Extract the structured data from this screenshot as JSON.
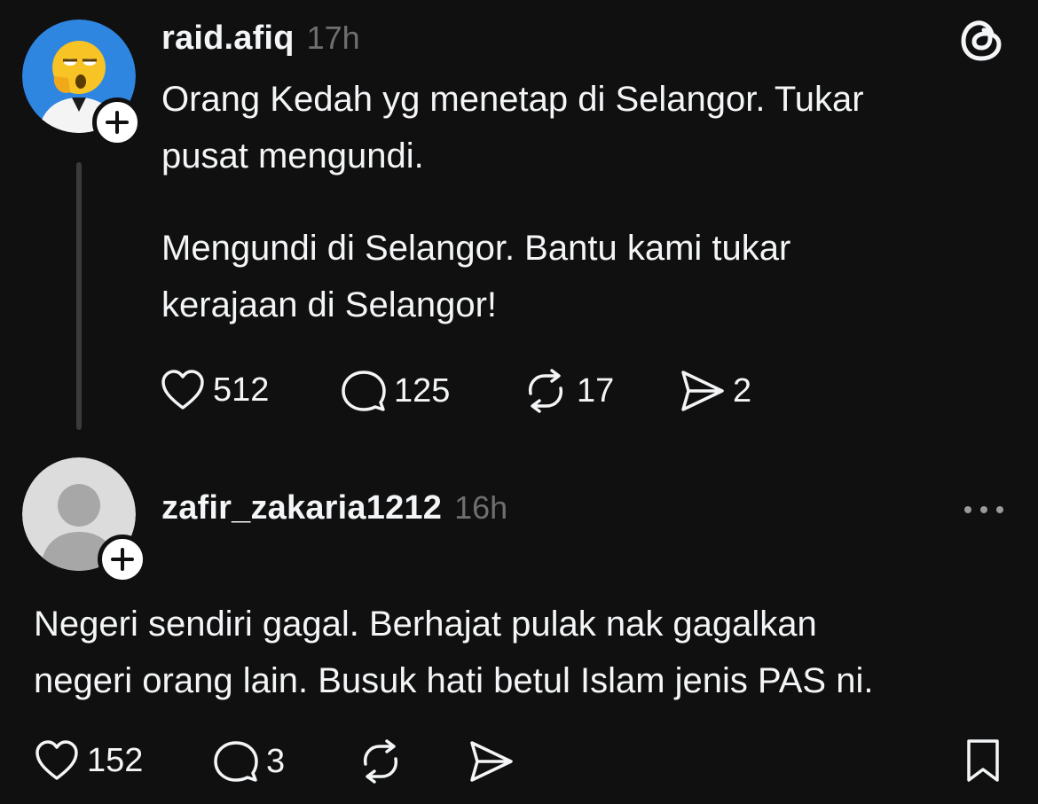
{
  "post": {
    "username": "raid.afiq",
    "time": "17h",
    "text_line1": "Orang Kedah yg menetap di Selangor. Tukar",
    "text_line2": "pusat mengundi.",
    "text_line3": "Mengundi di Selangor. Bantu kami tukar",
    "text_line4": "kerajaan di Selangor!",
    "likes": "512",
    "replies": "125",
    "reposts": "17",
    "shares": "2"
  },
  "reply": {
    "username": "zafir_zakaria1212",
    "time": "16h",
    "text_line1": "Negeri sendiri gagal. Berhajat pulak nak gagalkan",
    "text_line2": "negeri orang lain. Busuk hati betul Islam jenis PAS ni.",
    "likes": "152",
    "replies": "3"
  },
  "icons": {
    "app_logo": "threads-logo-icon",
    "like": "heart-icon",
    "reply": "comment-icon",
    "repost": "repost-icon",
    "share": "send-icon",
    "more": "more-dots-icon",
    "save": "bookmark-icon",
    "follow": "plus-icon"
  },
  "colors": {
    "background": "#101010",
    "text": "#f3f5f7",
    "muted": "#6f6f6f",
    "avatar_blue": "#2e86e0"
  }
}
